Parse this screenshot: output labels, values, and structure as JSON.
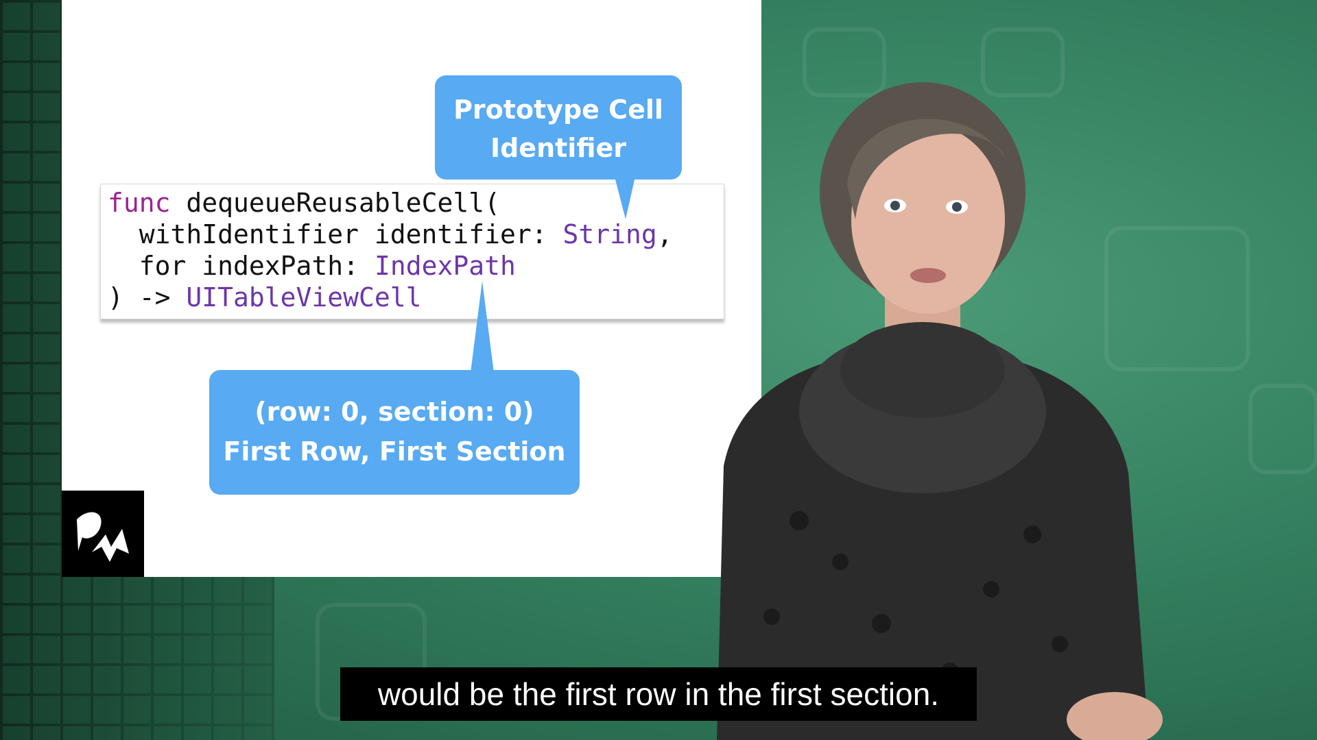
{
  "code": {
    "line1_kw": "func",
    "line1_rest": " dequeueReusableCell(",
    "line2_a": "  withIdentifier identifier: ",
    "line2_type": "String",
    "line2_b": ",",
    "line3_a": "  for indexPath: ",
    "line3_type": "IndexPath",
    "line4_a": ") -> ",
    "line4_type": "UITableViewCell"
  },
  "callouts": {
    "identifier": {
      "line1": "Prototype Cell",
      "line2": "Identifier"
    },
    "indexpath": {
      "line1": "(row: 0, section: 0)",
      "line2": "First Row, First Section"
    }
  },
  "caption": "would be the first row in the first section.",
  "colors": {
    "bubble": "#58aaf2",
    "keyword": "#9b2393",
    "type": "#6c36a9",
    "background_green": "#2f7a5a"
  }
}
